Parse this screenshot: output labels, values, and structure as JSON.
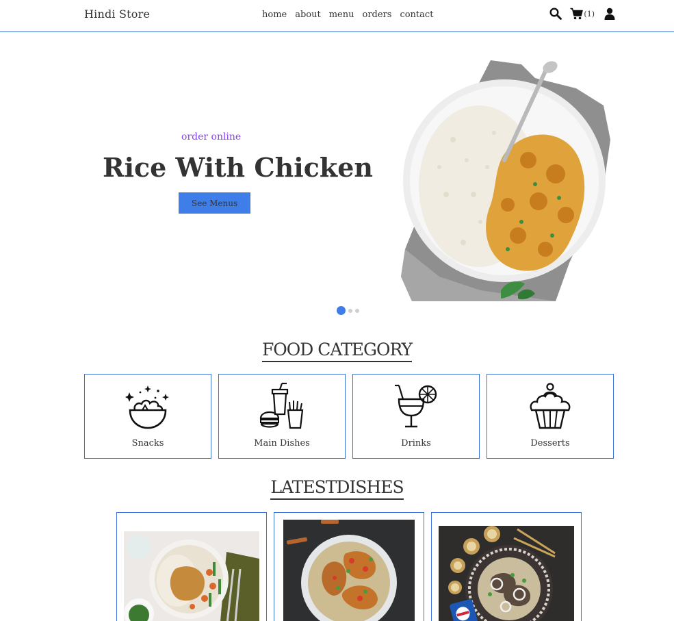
{
  "header": {
    "brand": "Hindi Store",
    "nav": [
      "home",
      "about",
      "menu",
      "orders",
      "contact"
    ],
    "icons": [
      "search-icon",
      "cart-icon",
      "user-icon"
    ],
    "cart_count": "(1)"
  },
  "hero": {
    "subtitle": "order online",
    "title": "Rice With Chicken",
    "button": "See Menus",
    "slides": 3,
    "active_slide": 1
  },
  "categories": {
    "title": "FOOD CATEGORY",
    "items": [
      {
        "label": "Snacks",
        "icon": "snacks-bowl-icon"
      },
      {
        "label": "Main Dishes",
        "icon": "burger-fries-icon"
      },
      {
        "label": "Drinks",
        "icon": "cocktail-icon"
      },
      {
        "label": "Desserts",
        "icon": "cupcake-icon"
      }
    ]
  },
  "latest": {
    "title": "LATESTDISHES"
  },
  "colors": {
    "accent": "#3f7ee8",
    "border": "#3b6fd6",
    "subtitle": "#8a3ffc"
  }
}
